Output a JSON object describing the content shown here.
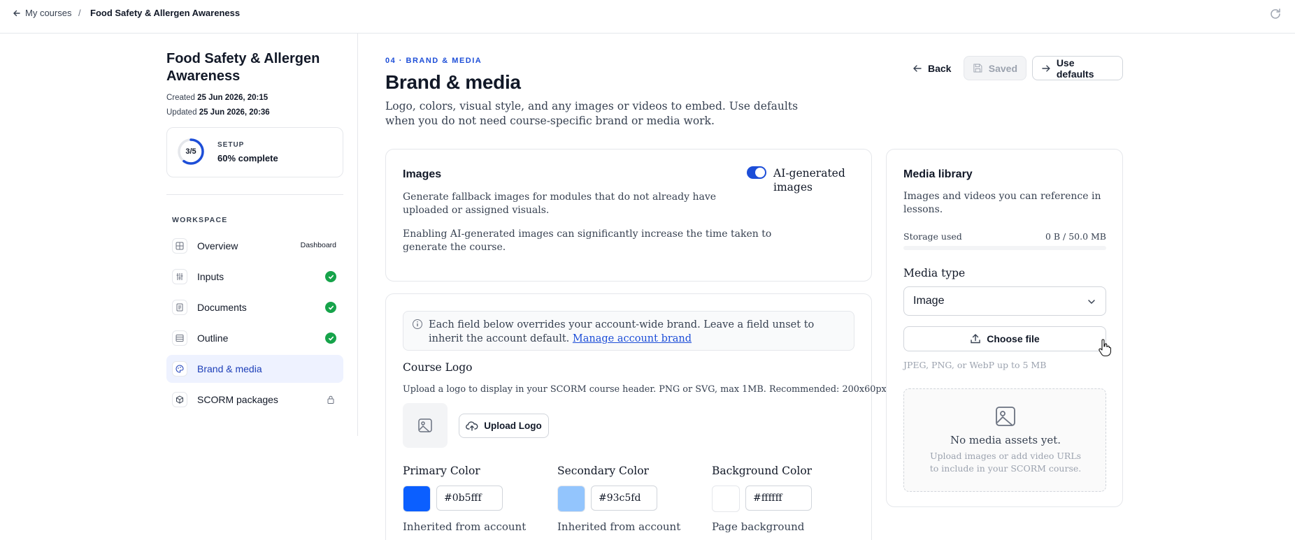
{
  "topbar": {
    "back_label": "My courses",
    "separator": "/",
    "current": "Food Safety & Allergen Awareness"
  },
  "sidebar": {
    "course_title": "Food Safety & Allergen Awareness",
    "created_label": "Created",
    "created_value": "25 Jun 2026, 20:15",
    "updated_label": "Updated",
    "updated_value": "25 Jun 2026, 20:36",
    "setup": {
      "progress": "3/5",
      "caption": "SETUP",
      "value": "60% complete",
      "fraction": 0.6
    },
    "workspace_caption": "WORKSPACE",
    "items": [
      {
        "label": "Overview",
        "badge": "Dashboard",
        "icon": "grid-icon"
      },
      {
        "label": "Inputs",
        "status": "complete",
        "icon": "sliders-icon"
      },
      {
        "label": "Documents",
        "status": "complete",
        "icon": "document-icon"
      },
      {
        "label": "Outline",
        "status": "complete",
        "icon": "list-icon"
      },
      {
        "label": "Brand & media",
        "status": "active",
        "icon": "palette-icon"
      },
      {
        "label": "SCORM packages",
        "status": "locked",
        "icon": "package-icon"
      }
    ]
  },
  "header": {
    "eyebrow": "04 · BRAND & MEDIA",
    "title": "Brand & media",
    "description": "Logo, colors, visual style, and any images or videos to embed. Use defaults when you do not need course-specific brand or media work.",
    "back_label": "Back",
    "saved_label": "Saved",
    "defaults_label": "Use defaults"
  },
  "images_card": {
    "title": "Images",
    "toggle_label": "AI-generated images",
    "toggle_on": true,
    "desc1": "Generate fallback images for modules that do not already have uploaded or assigned visuals.",
    "desc2": "Enabling AI-generated images can significantly increase the time taken to generate the course."
  },
  "brand_card": {
    "info_text": "Each field below overrides your account-wide brand. Leave a field unset to inherit the account default.",
    "info_link": "Manage account brand",
    "logo_title": "Course Logo",
    "logo_desc": "Upload a logo to display in your SCORM course header. PNG or SVG, max 1MB. Recommended: 200x60px.",
    "upload_label": "Upload Logo",
    "colors": [
      {
        "label": "Primary Color",
        "hex": "#0b5fff",
        "swatch": "#0b5fff",
        "note": "Inherited from account"
      },
      {
        "label": "Secondary Color",
        "hex": "#93c5fd",
        "swatch": "#93c5fd",
        "note": "Inherited from account"
      },
      {
        "label": "Background Color",
        "hex": "#ffffff",
        "swatch": "#ffffff",
        "note": "Page background"
      }
    ]
  },
  "media_card": {
    "title": "Media library",
    "desc": "Images and videos you can reference in lessons.",
    "storage_label": "Storage used",
    "storage_value": "0 B / 50.0 MB",
    "storage_fraction": 0,
    "type_label": "Media type",
    "type_value": "Image",
    "choose_label": "Choose file",
    "hint": "JPEG, PNG, or WebP up to 5 MB",
    "empty_title": "No media assets yet.",
    "empty_sub": "Upload images or add video URLs to include in your SCORM course."
  },
  "colors": {
    "accent": "#1d4ed8",
    "success": "#16a34a",
    "active_bg": "#eef2ff"
  }
}
